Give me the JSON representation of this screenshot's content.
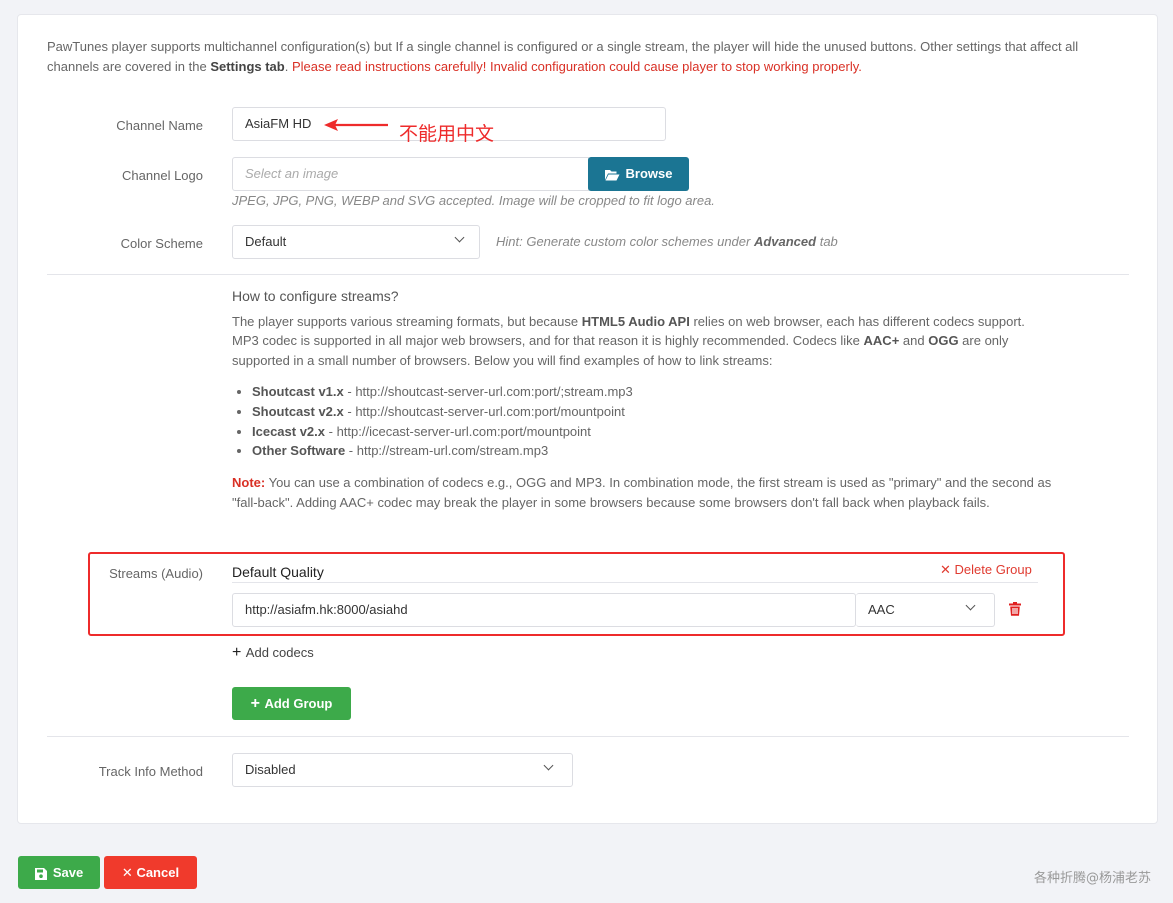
{
  "intro": {
    "text_a": "PawTunes player supports multichannel configuration(s) but If a single channel is configured or a single stream, the player will hide the unused buttons. Other settings that affect all channels are covered in the ",
    "settings_tab": "Settings tab",
    "text_b": ". ",
    "warning": "Please read instructions carefully! Invalid configuration could cause player to stop working properly."
  },
  "channel_name": {
    "label": "Channel Name",
    "value": "AsiaFM HD"
  },
  "annotation": {
    "text": "不能用中文",
    "color": "#ee2b2b"
  },
  "channel_logo": {
    "label": "Channel Logo",
    "placeholder": "Select an image",
    "browse_label": "Browse",
    "help": "JPEG, JPG, PNG, WEBP and SVG accepted. Image will be cropped to fit logo area."
  },
  "color_scheme": {
    "label": "Color Scheme",
    "value": "Default",
    "hint_a": "Hint: Generate custom color schemes under ",
    "hint_b": "Advanced",
    "hint_c": " tab"
  },
  "howto": {
    "title": "How to configure streams?",
    "p1_a": "The player supports various streaming formats, but because ",
    "p1_b": "HTML5 Audio API",
    "p1_c": " relies on web browser, each has different codecs support. MP3 codec is supported in all major web browsers, and for that reason it is highly recommended. Codecs like ",
    "p1_d": "AAC+",
    "p1_e": " and ",
    "p1_f": "OGG",
    "p1_g": " are only supported in a small number of browsers. Below you will find examples of how to link streams:",
    "examples": [
      {
        "name": "Shoutcast v1.x",
        "url": " - http://shoutcast-server-url.com:port/;stream.mp3"
      },
      {
        "name": "Shoutcast v2.x",
        "url": " - http://shoutcast-server-url.com:port/mountpoint"
      },
      {
        "name": "Icecast v2.x",
        "url": " - http://icecast-server-url.com:port/mountpoint"
      },
      {
        "name": "Other Software",
        "url": " - http://stream-url.com/stream.mp3"
      }
    ],
    "note_label": "Note:",
    "note_text": " You can use a combination of codecs e.g., OGG and MP3. In combination mode, the first stream is used as \"primary\" and the second as \"fall-back\". Adding AAC+ codec may break the player in some browsers because some browsers don't fall back when playback fails."
  },
  "streams": {
    "label": "Streams (Audio)",
    "group_title": "Default Quality",
    "delete_group": "Delete Group",
    "url_value": "http://asiafm.hk:8000/asiahd",
    "codec_value": "AAC",
    "add_codecs": "Add codecs",
    "add_group": "Add Group"
  },
  "track_info": {
    "label": "Track Info Method",
    "value": "Disabled"
  },
  "footer": {
    "save_label": "Save",
    "cancel_label": "Cancel"
  },
  "watermark": "各种折腾@杨浦老苏",
  "colors": {
    "browse": "#1b7593",
    "green": "#3daa4a",
    "red": "#f03a2c",
    "warning": "#d93025"
  }
}
